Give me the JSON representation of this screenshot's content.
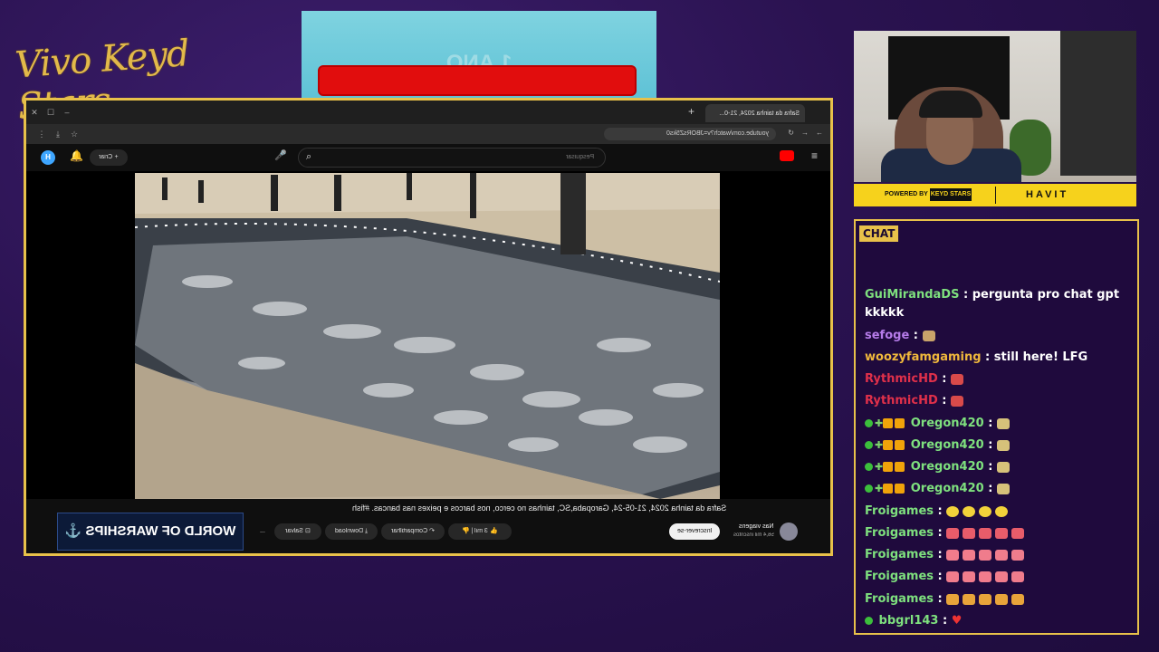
{
  "overlay": {
    "logo_text": "Vivo Keyd Stars",
    "banner_text": "1 ANO",
    "sponsor": {
      "powered_by": "POWERED BY",
      "keyd": "KEYD STARS",
      "havit": "HAVIT"
    }
  },
  "browser": {
    "tab_title": "Safra da tainha 2024, 21-0...",
    "url": "youtube.com/watch?v=JBORsZ5ks0",
    "search_placeholder": "Pesquisar",
    "create_label": "Criar"
  },
  "video": {
    "title": "Safra da tainha 2024, 21-05-24, Garopaba,SC, tainhas no cerco, nos barcos e peixes nas bancas. #fish",
    "channel_name": "Nas viagens",
    "channel_subs": "56,4 mil inscritos",
    "subscribe_label": "Inscrever-se",
    "likes": "3 mil",
    "share_label": "Compartilhar",
    "download_label": "Download",
    "save_label": "Salvar",
    "more_label": "..."
  },
  "ad": {
    "text": "WORLD OF WARSHIPS"
  },
  "chat": {
    "title": "CHAT",
    "messages": [
      {
        "user": "GuiMirandaDS",
        "color": "#7ee07e",
        "text": "pergunta pro chat gpt"
      },
      {
        "user": "",
        "color": "#ffffff",
        "text": "kkkkk"
      },
      {
        "user": "sefoge",
        "color": "#b57be8",
        "text": ""
      },
      {
        "user": "woozyfamgaming",
        "color": "#f0b83c",
        "text": "still here! LFG"
      },
      {
        "user": "RythmicHD",
        "color": "#e0304a",
        "text": ""
      },
      {
        "user": "RythmicHD",
        "color": "#e0304a",
        "text": ""
      },
      {
        "user": "Oregon420",
        "color": "#7ee07e",
        "text": ""
      },
      {
        "user": "Oregon420",
        "color": "#7ee07e",
        "text": ""
      },
      {
        "user": "Oregon420",
        "color": "#7ee07e",
        "text": ""
      },
      {
        "user": "Oregon420",
        "color": "#7ee07e",
        "text": ""
      },
      {
        "user": "Froigames",
        "color": "#7ee07e",
        "text": ""
      },
      {
        "user": "Froigames",
        "color": "#7ee07e",
        "text": ""
      },
      {
        "user": "Froigames",
        "color": "#7ee07e",
        "text": ""
      },
      {
        "user": "Froigames",
        "color": "#7ee07e",
        "text": ""
      },
      {
        "user": "Froigames",
        "color": "#7ee07e",
        "text": ""
      },
      {
        "user": "bbgrl143",
        "color": "#7ee07e",
        "text": ""
      }
    ]
  },
  "colors": {
    "frame_gold": "#e8c14a",
    "bg_purple": "#2a1250",
    "subscribe_bg": "#f1f1f1"
  }
}
